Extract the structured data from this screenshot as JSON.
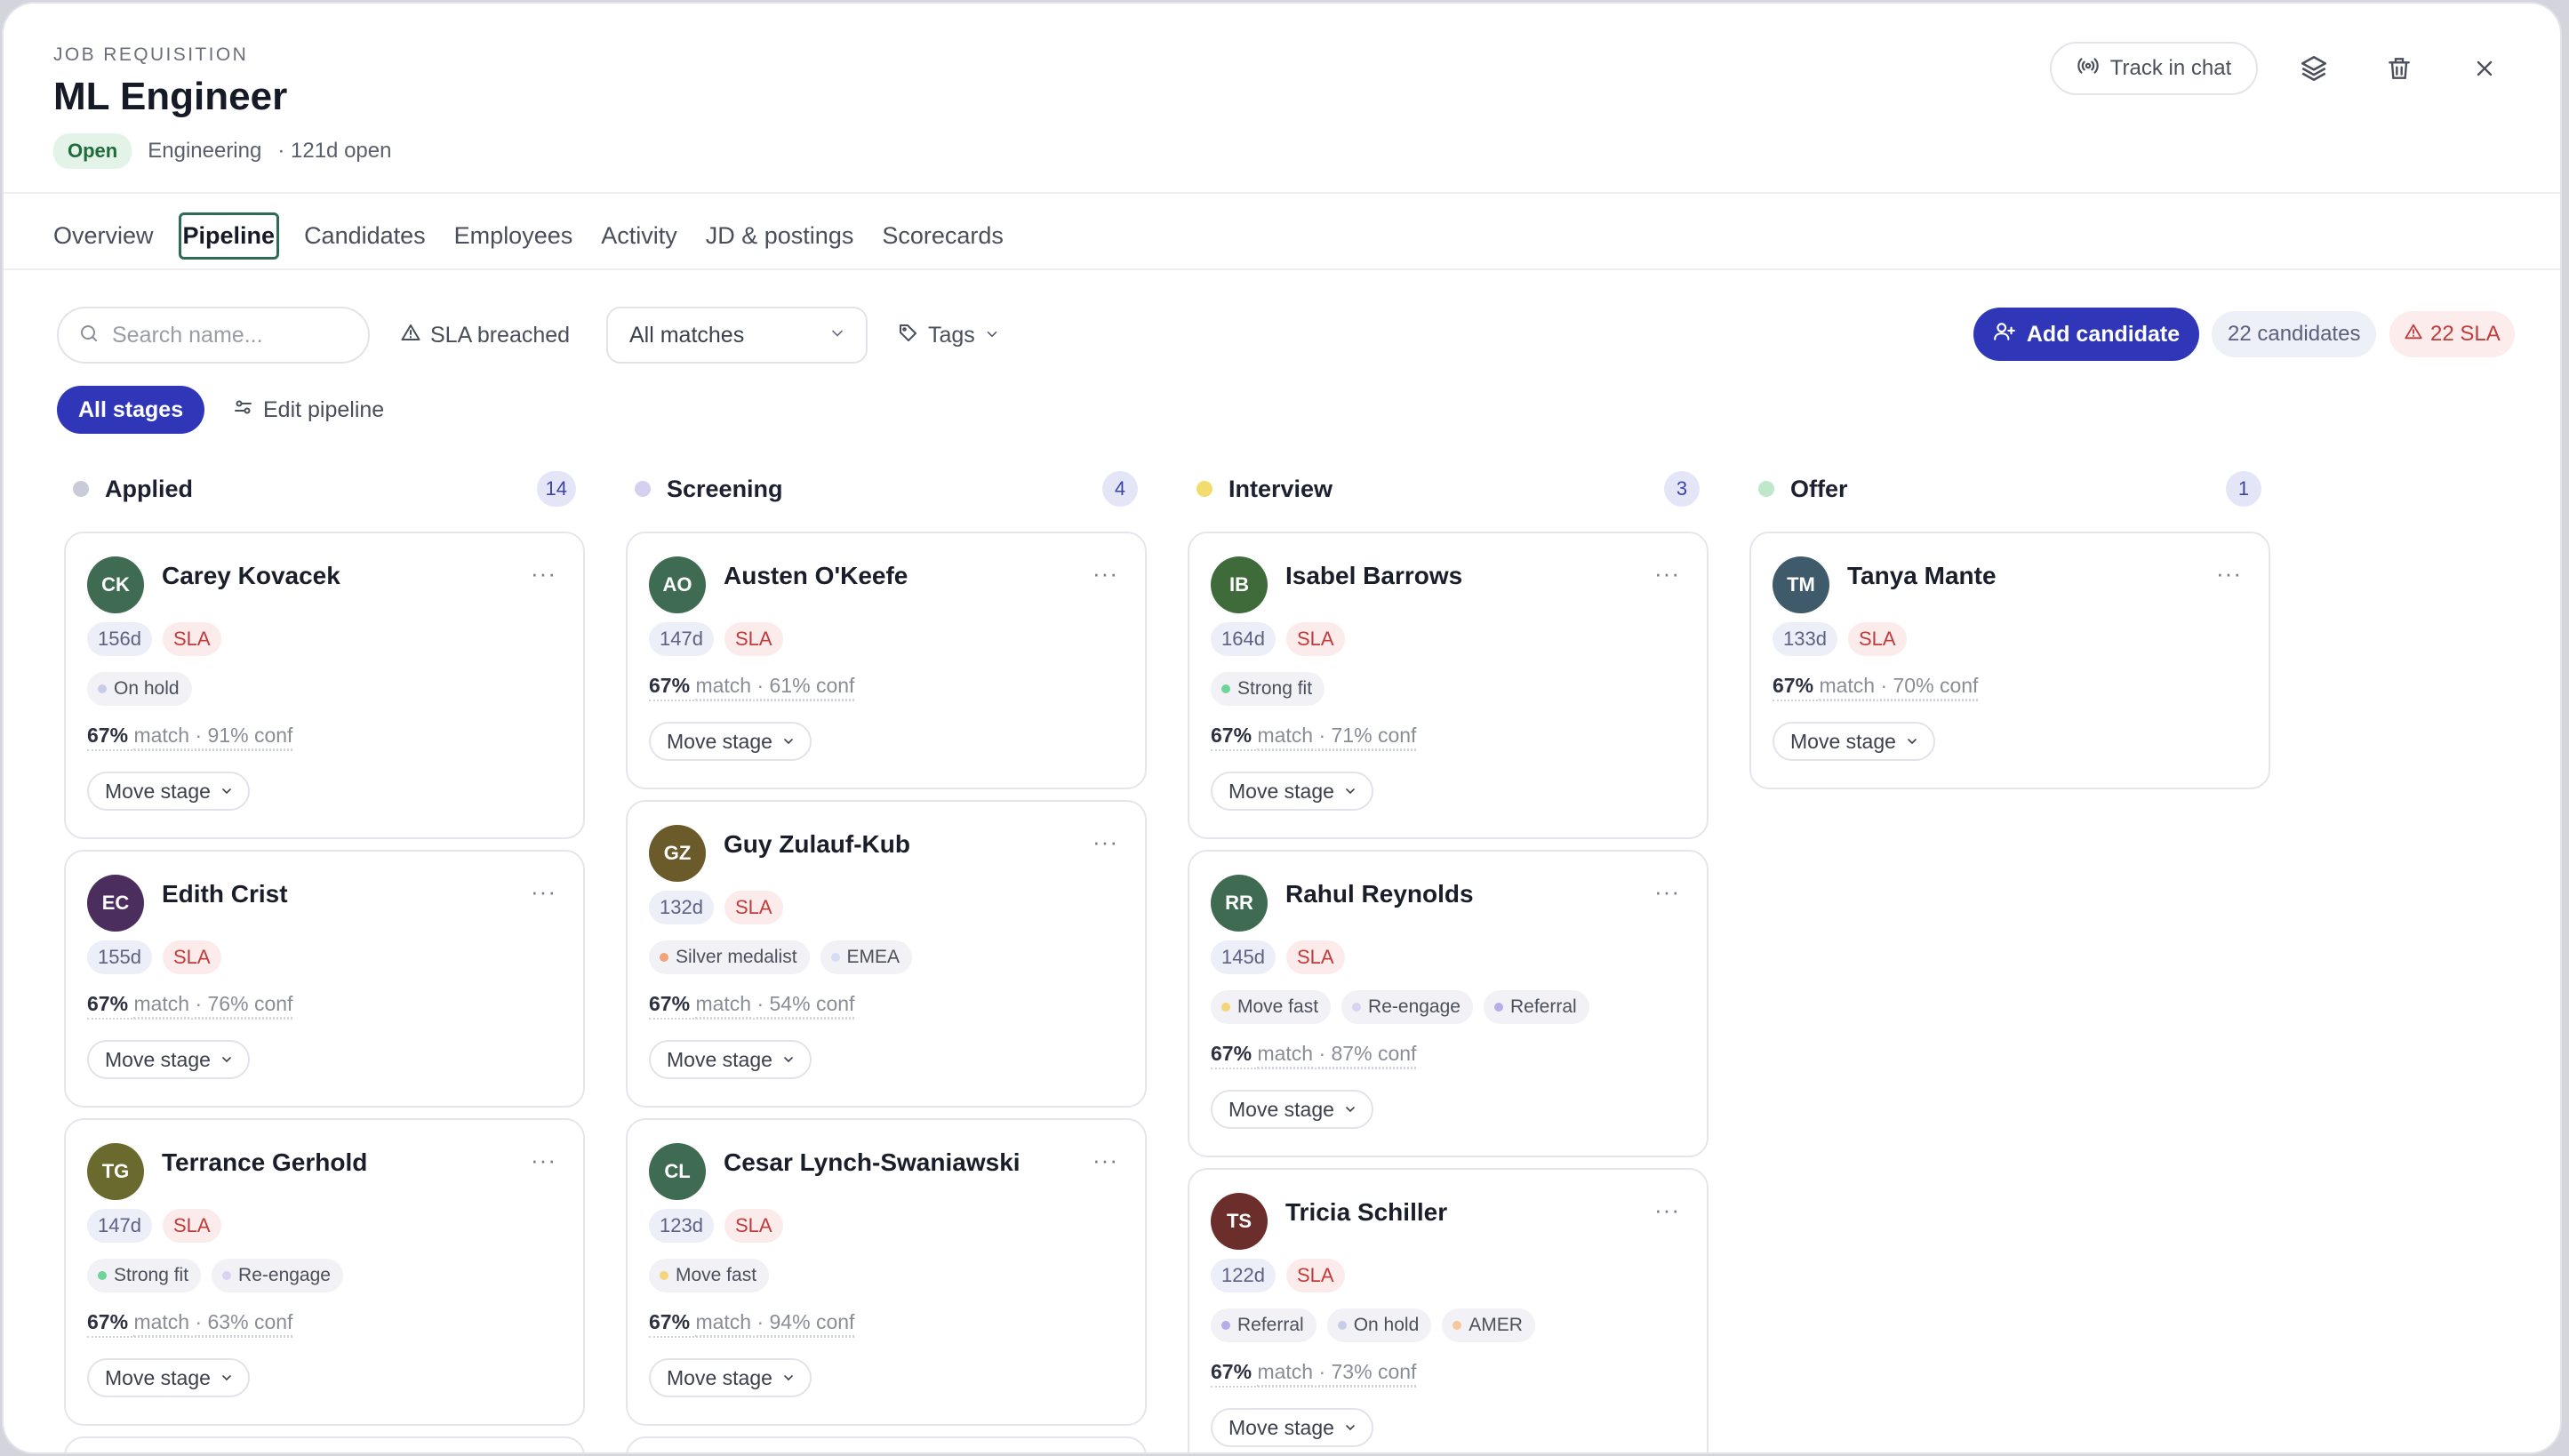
{
  "header": {
    "eyebrow": "JOB REQUISITION",
    "title": "ML Engineer",
    "status": "Open",
    "department": "Engineering",
    "open_for": "· 121d open",
    "track_label": "Track in chat",
    "icons": [
      "broadcast-icon",
      "layers-icon",
      "trash-icon",
      "close-icon"
    ]
  },
  "tabs": [
    {
      "label": "Overview"
    },
    {
      "label": "Pipeline",
      "active": true
    },
    {
      "label": "Candidates"
    },
    {
      "label": "Employees"
    },
    {
      "label": "Activity"
    },
    {
      "label": "JD & postings"
    },
    {
      "label": "Scorecards"
    }
  ],
  "toolbar": {
    "search_placeholder": "Search name...",
    "sla_breached": "SLA breached",
    "matches_value": "All matches",
    "tags_label": "Tags",
    "add_candidate": "Add candidate",
    "candidates_count": "22 candidates",
    "sla_count": "22 SLA",
    "all_stages": "All stages",
    "edit_pipeline": "Edit pipeline"
  },
  "colors": {
    "accent": "#2f37b8",
    "sla_red": "#c23b3b",
    "applied_dot": "#c9ccd8",
    "screening_dot": "#d6d0f0",
    "interview_dot": "#f3dc6e",
    "offer_dot": "#bfe7c9"
  },
  "columns": [
    {
      "title": "Applied",
      "count": "14",
      "cards": [
        {
          "initials": "CK",
          "name": "Carey Kovacek",
          "days": "156d",
          "sla": "SLA",
          "tags": [
            {
              "label": "On hold",
              "dot": "#c9cce8"
            }
          ],
          "match": "67%",
          "match_word": "match",
          "conf": "· 91% conf",
          "move": "Move stage",
          "avatar": "#3f6b53"
        },
        {
          "initials": "EC",
          "name": "Edith Crist",
          "days": "155d",
          "sla": "SLA",
          "tags": [],
          "match": "67%",
          "match_word": "match",
          "conf": "· 76% conf",
          "move": "Move stage",
          "avatar": "#4b2e5e"
        },
        {
          "initials": "TG",
          "name": "Terrance Gerhold",
          "days": "147d",
          "sla": "SLA",
          "tags": [
            {
              "label": "Strong fit",
              "dot": "#6fd49a"
            },
            {
              "label": "Re-engage",
              "dot": "#d9d2f2"
            }
          ],
          "match": "67%",
          "match_word": "match",
          "conf": "· 63% conf",
          "move": "Move stage",
          "avatar": "#6b6a2e"
        }
      ]
    },
    {
      "title": "Screening",
      "count": "4",
      "cards": [
        {
          "initials": "AO",
          "name": "Austen O'Keefe",
          "days": "147d",
          "sla": "SLA",
          "tags": [],
          "match": "67%",
          "match_word": "match",
          "conf": "· 61% conf",
          "move": "Move stage",
          "avatar": "#3f6b53"
        },
        {
          "initials": "GZ",
          "name": "Guy Zulauf-Kub",
          "days": "132d",
          "sla": "SLA",
          "tags": [
            {
              "label": "Silver medalist",
              "dot": "#f2a37a"
            },
            {
              "label": "EMEA",
              "dot": "#d6dcf4"
            }
          ],
          "match": "67%",
          "match_word": "match",
          "conf": "· 54% conf",
          "move": "Move stage",
          "avatar": "#6b5a2a"
        },
        {
          "initials": "CL",
          "name": "Cesar Lynch-Swaniawski",
          "days": "123d",
          "sla": "SLA",
          "tags": [
            {
              "label": "Move fast",
              "dot": "#f3d57a"
            }
          ],
          "match": "67%",
          "match_word": "match",
          "conf": "· 94% conf",
          "move": "Move stage",
          "avatar": "#3f6b53"
        }
      ]
    },
    {
      "title": "Interview",
      "count": "3",
      "cards": [
        {
          "initials": "IB",
          "name": "Isabel Barrows",
          "days": "164d",
          "sla": "SLA",
          "tags": [
            {
              "label": "Strong fit",
              "dot": "#6fd49a"
            }
          ],
          "match": "67%",
          "match_word": "match",
          "conf": "· 71% conf",
          "move": "Move stage",
          "avatar": "#3f6b3a"
        },
        {
          "initials": "RR",
          "name": "Rahul Reynolds",
          "days": "145d",
          "sla": "SLA",
          "tags": [
            {
              "label": "Move fast",
              "dot": "#f3d57a"
            },
            {
              "label": "Re-engage",
              "dot": "#d9d2f2"
            },
            {
              "label": "Referral",
              "dot": "#b6aee8"
            }
          ],
          "match": "67%",
          "match_word": "match",
          "conf": "· 87% conf",
          "move": "Move stage",
          "avatar": "#3f6b53"
        },
        {
          "initials": "TS",
          "name": "Tricia Schiller",
          "days": "122d",
          "sla": "SLA",
          "tags": [
            {
              "label": "Referral",
              "dot": "#b6aee8"
            },
            {
              "label": "On hold",
              "dot": "#c9cce8"
            },
            {
              "label": "AMER",
              "dot": "#f4c89a"
            }
          ],
          "match": "67%",
          "match_word": "match",
          "conf": "· 73% conf",
          "move": "Move stage",
          "avatar": "#6b2e2a"
        }
      ]
    },
    {
      "title": "Offer",
      "count": "1",
      "cards": [
        {
          "initials": "TM",
          "name": "Tanya Mante",
          "days": "133d",
          "sla": "SLA",
          "tags": [],
          "match": "67%",
          "match_word": "match",
          "conf": "· 70% conf",
          "move": "Move stage",
          "avatar": "#3f5a6b"
        }
      ]
    }
  ]
}
